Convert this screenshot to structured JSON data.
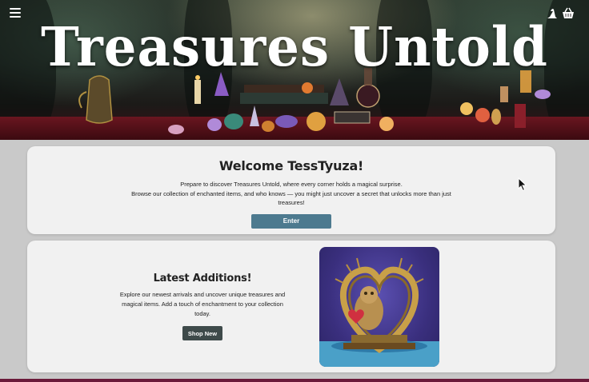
{
  "header": {
    "title": "Treasures Untold",
    "menu_icon": "hamburger-menu-icon",
    "right_icons": [
      "wizard-hat-icon",
      "basket-icon"
    ]
  },
  "welcome": {
    "heading": "Welcome TessTyuza!",
    "line1": "Prepare to discover Treasures Untold, where every corner holds a magical surprise.",
    "line2": "Browse our collection of enchanted items, and who knows — you might just uncover a secret that unlocks more than just treasures!",
    "button_label": "Enter"
  },
  "latest": {
    "heading": "Latest Additions!",
    "body": "Explore our newest arrivals and uncover unique treasures and magical items. Add a touch of enchantment to your collection today.",
    "button_label": "Shop New"
  },
  "colors": {
    "enter_button": "#4d7a8f",
    "shop_button": "#3e4a4a",
    "card_bg": "#f1f1f1",
    "page_bg": "#c9c9c9"
  }
}
